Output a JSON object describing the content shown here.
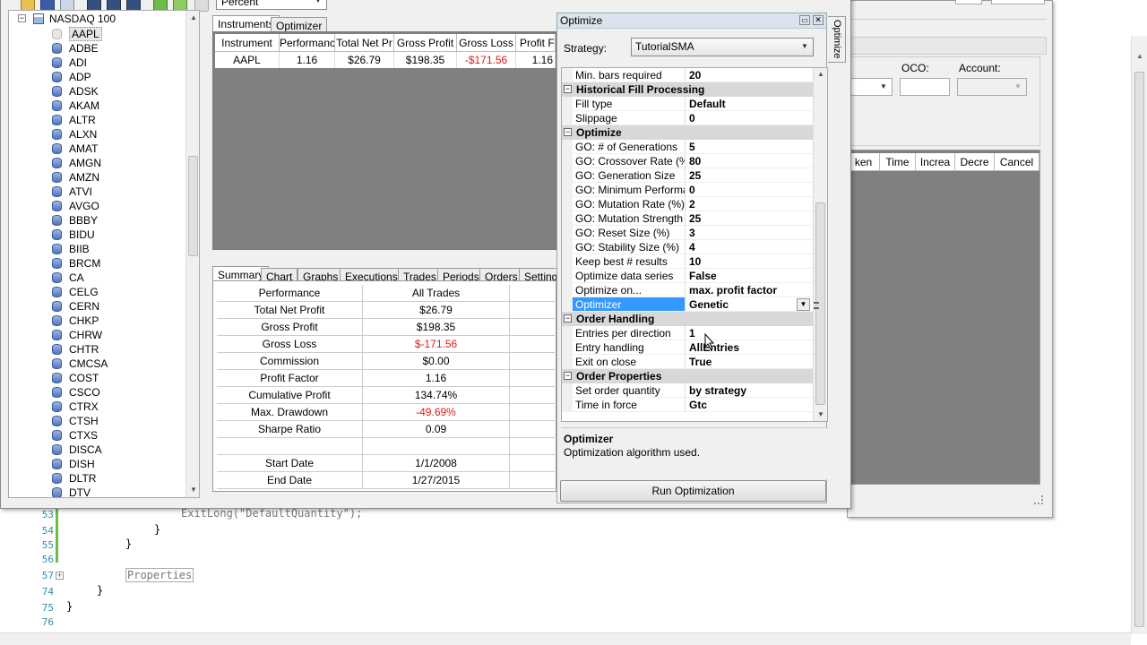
{
  "toolbar": {
    "view_label": "Percent"
  },
  "tree": {
    "root_label": "NASDAQ 100",
    "items": [
      "AAPL",
      "ADBE",
      "ADI",
      "ADP",
      "ADSK",
      "AKAM",
      "ALTR",
      "ALXN",
      "AMAT",
      "AMGN",
      "AMZN",
      "ATVI",
      "AVGO",
      "BBBY",
      "BIDU",
      "BIIB",
      "BRCM",
      "CA",
      "CELG",
      "CERN",
      "CHKP",
      "CHRW",
      "CHTR",
      "CMCSA",
      "COST",
      "CSCO",
      "CTRX",
      "CTSH",
      "CTXS",
      "DISCA",
      "DISH",
      "DLTR",
      "DTV"
    ]
  },
  "top_tabs": [
    "Instruments",
    "Optimizer"
  ],
  "instruments_grid": {
    "headers": [
      "Instrument",
      "Performanc",
      "Total Net Pr",
      "Gross Profit",
      "Gross Loss",
      "Profit Fa"
    ],
    "row": [
      "AAPL",
      "1.16",
      "$26.79",
      "$198.35",
      "-$171.56",
      "1.16"
    ]
  },
  "bottom_tabs": [
    "Summary",
    "Chart",
    "Graphs",
    "Executions",
    "Trades",
    "Periods",
    "Orders",
    "Settings"
  ],
  "summary": {
    "header": [
      "Performance",
      "All Trades"
    ],
    "rows": [
      [
        "Total Net Profit",
        "$26.79"
      ],
      [
        "Gross Profit",
        "$198.35"
      ],
      [
        "Gross Loss",
        "$-171.56"
      ],
      [
        "Commission",
        "$0.00"
      ],
      [
        "Profit Factor",
        "1.16"
      ],
      [
        "Cumulative Profit",
        "134.74%"
      ],
      [
        "Max. Drawdown",
        "-49.69%"
      ],
      [
        "Sharpe Ratio",
        "0.09"
      ],
      [
        "",
        ""
      ],
      [
        "Start Date",
        "1/1/2008"
      ],
      [
        "End Date",
        "1/27/2015"
      ]
    ]
  },
  "optimize": {
    "title": "Optimize",
    "side_tab": "Optimize",
    "strategy_label": "Strategy:",
    "strategy_value": "TutorialSMA",
    "properties": [
      {
        "type": "row",
        "k": "Min. bars required",
        "v": "20"
      },
      {
        "type": "cat",
        "k": "Historical Fill Processing"
      },
      {
        "type": "row",
        "k": "Fill type",
        "v": "Default"
      },
      {
        "type": "row",
        "k": "Slippage",
        "v": "0"
      },
      {
        "type": "cat",
        "k": "Optimize"
      },
      {
        "type": "row",
        "k": "GO: # of Generations",
        "v": "5"
      },
      {
        "type": "row",
        "k": "GO: Crossover Rate (%)",
        "v": "80"
      },
      {
        "type": "row",
        "k": "GO: Generation Size",
        "v": "25"
      },
      {
        "type": "row",
        "k": "GO: Minimum Performan",
        "v": "0"
      },
      {
        "type": "row",
        "k": "GO: Mutation Rate (%)",
        "v": "2"
      },
      {
        "type": "row",
        "k": "GO: Mutation Strength (%",
        "v": "25"
      },
      {
        "type": "row",
        "k": "GO: Reset Size (%)",
        "v": "3"
      },
      {
        "type": "row",
        "k": "GO: Stability Size (%)",
        "v": "4"
      },
      {
        "type": "row",
        "k": "Keep best # results",
        "v": "10"
      },
      {
        "type": "row",
        "k": "Optimize data series",
        "v": "False"
      },
      {
        "type": "row",
        "k": "Optimize on...",
        "v": "max. profit factor"
      },
      {
        "type": "sel",
        "k": "Optimizer",
        "v": "Genetic"
      },
      {
        "type": "cat",
        "k": "Order Handling"
      },
      {
        "type": "row",
        "k": "Entries per direction",
        "v": "1"
      },
      {
        "type": "row",
        "k": "Entry handling",
        "v": "AllEntries"
      },
      {
        "type": "row",
        "k": "Exit on close",
        "v": "True"
      },
      {
        "type": "cat",
        "k": "Order Properties"
      },
      {
        "type": "row",
        "k": "Set order quantity",
        "v": "by strategy"
      },
      {
        "type": "row",
        "k": "Time in force",
        "v": "Gtc"
      }
    ],
    "desc_title": "Optimizer",
    "desc_text": "Optimization algorithm used.",
    "run_button": "Run Optimization"
  },
  "order_window": {
    "oco_label": "OCO:",
    "account_label": "Account:",
    "grid_headers": [
      "ken",
      "Time",
      "Increa",
      "Decre",
      "Cancel"
    ]
  },
  "editor": {
    "lines": [
      {
        "n": "53",
        "code": "ExitLong(\"DefaultQuantity\");"
      },
      {
        "n": "54",
        "code": "}"
      },
      {
        "n": "55",
        "code": "}"
      },
      {
        "n": "56",
        "code": ""
      },
      {
        "n": "57",
        "code": "Properties"
      },
      {
        "n": "74",
        "code": "}"
      },
      {
        "n": "75",
        "code": "}"
      },
      {
        "n": "76",
        "code": ""
      }
    ]
  },
  "colors": {
    "selection": "#3399ff",
    "loss_red": "#e0191a",
    "line_number": "#2b91af"
  }
}
